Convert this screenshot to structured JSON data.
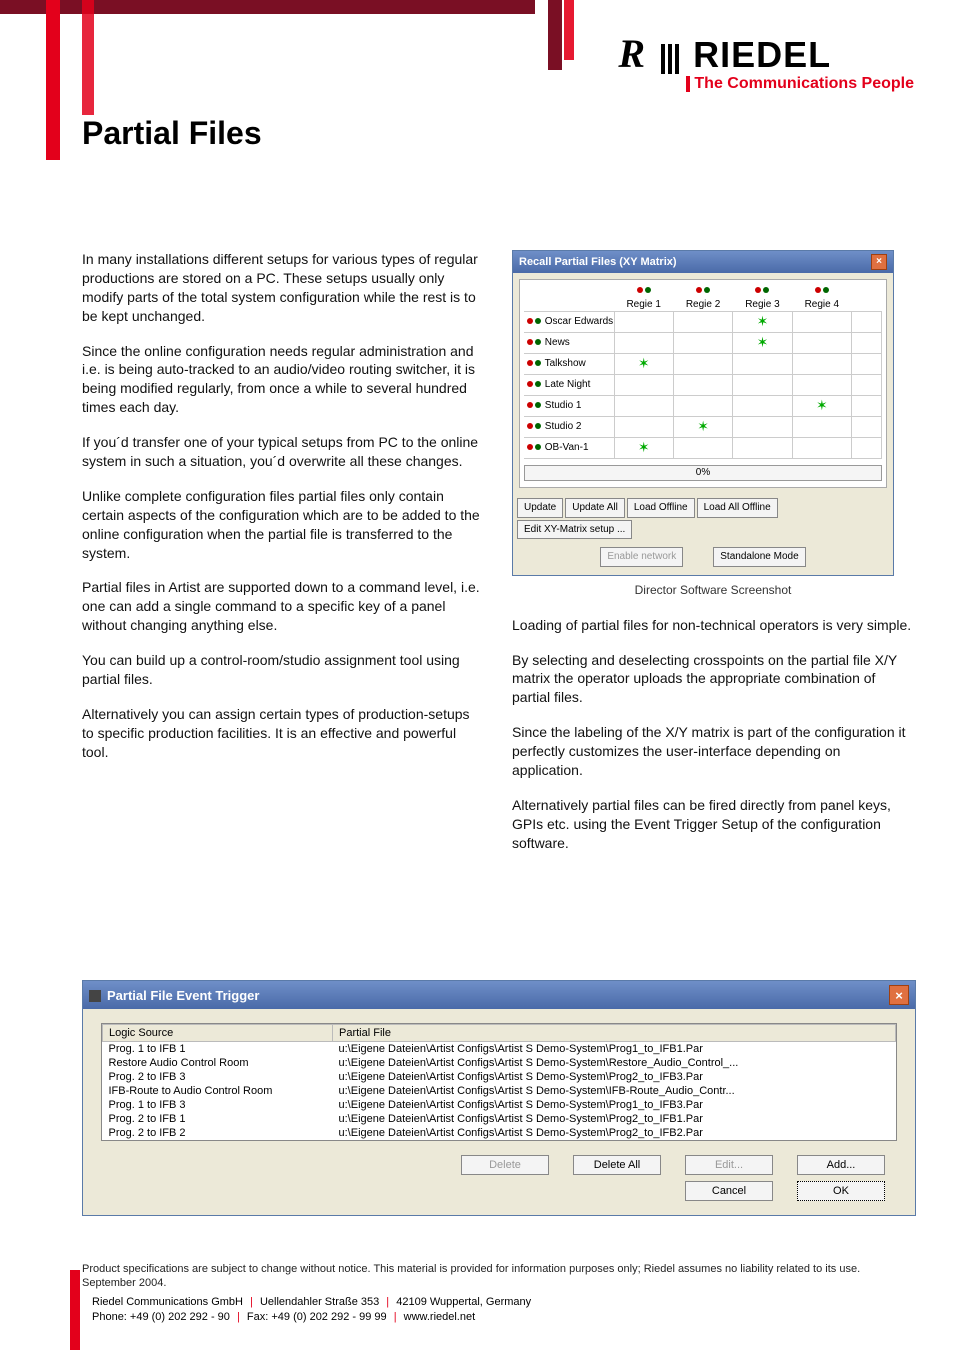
{
  "logo": {
    "brand": "RIEDEL",
    "tagline": "The Communications People"
  },
  "page_title": "Partial Files",
  "left_paragraphs": [
    "In many installations different setups for various types of regular productions are stored on a PC. These setups usually only modify parts of the total system configuration while the rest is to be kept unchanged.",
    "Since the online configuration needs regular administration and i.e. is being auto-tracked to an audio/video routing switcher, it is being modified regularly, from once a while to several hundred times each day.",
    "If you´d transfer one of your typical setups from PC to the online system in such a situation, you´d overwrite all these changes.",
    "Unlike complete configuration files partial files only contain certain aspects of the configuration which are to be added to the online configuration when the partial file is transferred to the system.",
    "Partial files in Artist are supported down to a command level, i.e. one can add a single command to a specific key of a panel without changing anything else.",
    "You can build up a control-room/studio assignment tool using partial files.",
    "Alternatively you can assign certain types of production-setups to specific production facilities. It is an effective and powerful tool."
  ],
  "shot1": {
    "title": "Recall Partial Files (XY Matrix)",
    "cols": [
      "Regie 1",
      "Regie 2",
      "Regie 3",
      "Regie 4"
    ],
    "rows": [
      "Oscar Edwards",
      "News",
      "Talkshow",
      "Late Night",
      "Studio 1",
      "Studio 2",
      "OB-Van-1"
    ],
    "crosspoints": [
      {
        "row": 0,
        "col": 2
      },
      {
        "row": 2,
        "col": 0
      },
      {
        "row": 1,
        "col": 2
      },
      {
        "row": 4,
        "col": 3
      },
      {
        "row": 5,
        "col": 1
      },
      {
        "row": 6,
        "col": 0
      }
    ],
    "progress": "0%",
    "buttons": [
      "Update",
      "Update All",
      "Load Offline",
      "Load All Offline",
      "Edit XY-Matrix setup ..."
    ],
    "buttons2": [
      "Enable network",
      "Standalone Mode"
    ]
  },
  "shot1_caption": "Director Software Screenshot",
  "right_paragraphs": [
    "Loading of partial files for non-technical operators is very simple.",
    "By selecting and deselecting crosspoints on the partial file X/Y matrix the operator uploads the appropriate combination of partial files.",
    "Since the labeling of the X/Y matrix is part of the configuration it perfectly customizes the user-interface depending on application.",
    "Alternatively partial files can be fired directly from panel keys, GPIs etc. using the Event Trigger Setup of the configuration software."
  ],
  "shot2": {
    "title": "Partial File Event Trigger",
    "headers": [
      "Logic Source",
      "Partial File"
    ],
    "rows": [
      [
        "Prog. 1 to IFB 1",
        "u:\\Eigene Dateien\\Artist Configs\\Artist S Demo-System\\Prog1_to_IFB1.Par"
      ],
      [
        "Restore Audio Control Room",
        "u:\\Eigene Dateien\\Artist Configs\\Artist S Demo-System\\Restore_Audio_Control_..."
      ],
      [
        "Prog. 2 to IFB 3",
        "u:\\Eigene Dateien\\Artist Configs\\Artist S Demo-System\\Prog2_to_IFB3.Par"
      ],
      [
        "IFB-Route to Audio Control Room",
        "u:\\Eigene Dateien\\Artist Configs\\Artist S Demo-System\\IFB-Route_Audio_Contr..."
      ],
      [
        "Prog. 1 to IFB 3",
        "u:\\Eigene Dateien\\Artist Configs\\Artist S Demo-System\\Prog1_to_IFB3.Par"
      ],
      [
        "Prog. 2 to IFB 1",
        "u:\\Eigene Dateien\\Artist Configs\\Artist S Demo-System\\Prog2_to_IFB1.Par"
      ],
      [
        "Prog. 2 to IFB 2",
        "u:\\Eigene Dateien\\Artist Configs\\Artist S Demo-System\\Prog2_to_IFB2.Par"
      ]
    ],
    "buttons_row1": [
      {
        "label": "Delete",
        "disabled": true
      },
      {
        "label": "Delete All",
        "disabled": false
      },
      {
        "label": "Edit...",
        "disabled": true
      },
      {
        "label": "Add...",
        "disabled": false
      }
    ],
    "buttons_row2": [
      {
        "label": "Cancel",
        "disabled": false
      },
      {
        "label": "OK",
        "disabled": false,
        "default": true
      }
    ]
  },
  "disclaimer": "Product specifications are subject to change without notice. This material is provided for information purposes only; Riedel assumes no liability related to its use. September 2004.",
  "footer": {
    "company": "Riedel Communications GmbH",
    "street": "Uellendahler Straße 353",
    "city": "42109 Wuppertal, Germany",
    "phone": "Phone: +49 (0) 202 292 - 90",
    "fax": "Fax: +49 (0) 202 292 - 99 99",
    "web": "www.riedel.net"
  }
}
